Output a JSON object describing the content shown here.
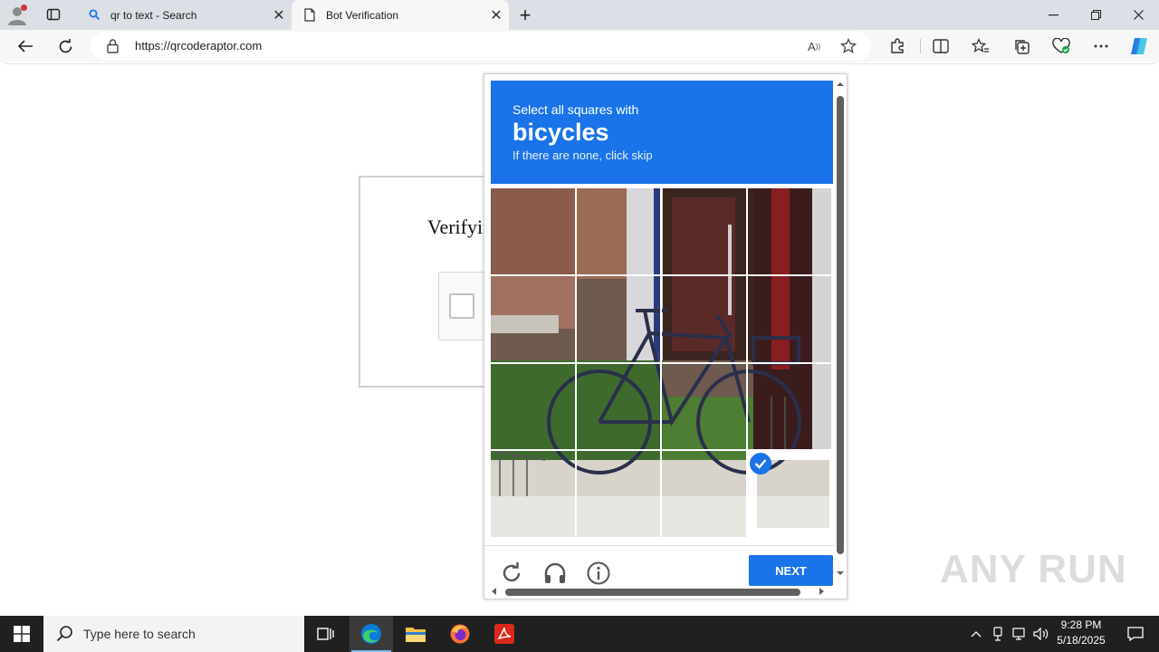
{
  "browser": {
    "tabs": [
      {
        "title": "qr to text - Search",
        "icon": "search-icon",
        "active": false
      },
      {
        "title": "Bot Verification",
        "icon": "page-icon",
        "active": true
      }
    ],
    "new_tab": "+",
    "window_controls": {
      "minimize": "—",
      "restore": "❐",
      "close": "✕"
    },
    "address": {
      "url": "https://qrcoderaptor.com"
    },
    "toolbar_icons": [
      "extensions-icon",
      "split-screen-icon",
      "favorites-icon",
      "collections-icon",
      "browser-essentials-icon",
      "more-icon",
      "copilot-icon"
    ]
  },
  "page": {
    "verify_title": "Verifying you are human"
  },
  "challenge": {
    "instruction_line1": "Select all squares with",
    "target": "bicycles",
    "instruction_line3": "If there are none, click skip",
    "grid": {
      "rows": 4,
      "cols": 4,
      "selected": [
        15
      ]
    },
    "footer_icons": [
      "reload-icon",
      "audio-icon",
      "info-icon"
    ],
    "next_label": "NEXT"
  },
  "watermark": "ANY RUN",
  "taskbar": {
    "search_placeholder": "Type here to search",
    "apps": [
      "task-view-icon",
      "edge-icon",
      "file-explorer-icon",
      "firefox-icon",
      "acrobat-icon"
    ],
    "time": "9:28 PM",
    "date": "5/18/2025"
  },
  "colors": {
    "accent": "#1a73e8",
    "taskbar": "#202020"
  }
}
